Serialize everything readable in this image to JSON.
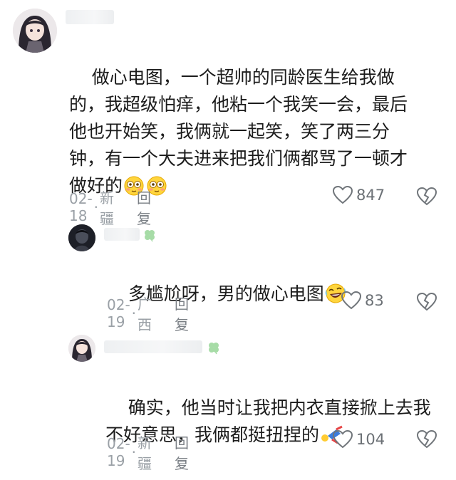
{
  "comments": [
    {
      "text": "做心电图，一个超帅的同龄医生给我做的，我超级怕痒，他粘一个我笑一会，最后他也开始笑，我俩就一起笑，笑了两三分钟，有一个大夫进来把我们俩都骂了一顿才做好的",
      "date": "02-18",
      "sep": "·",
      "location": "新疆",
      "reply_label": "回复",
      "likes": "847"
    },
    {
      "text": "多尴尬呀，男的做心电图",
      "date": "02-19",
      "sep": "·",
      "location": "广西",
      "reply_label": "回复",
      "likes": "83"
    },
    {
      "text": "确实，他当时让我把内衣直接掀上去我不好意思，我俩都挺扭捏的",
      "date": "02-19",
      "sep": "·",
      "location": "新疆",
      "reply_label": "回复",
      "likes": "104"
    }
  ],
  "colors": {
    "meta": "#9aa0a6",
    "text": "#1c1c1c",
    "clover": "#9ad49a"
  }
}
